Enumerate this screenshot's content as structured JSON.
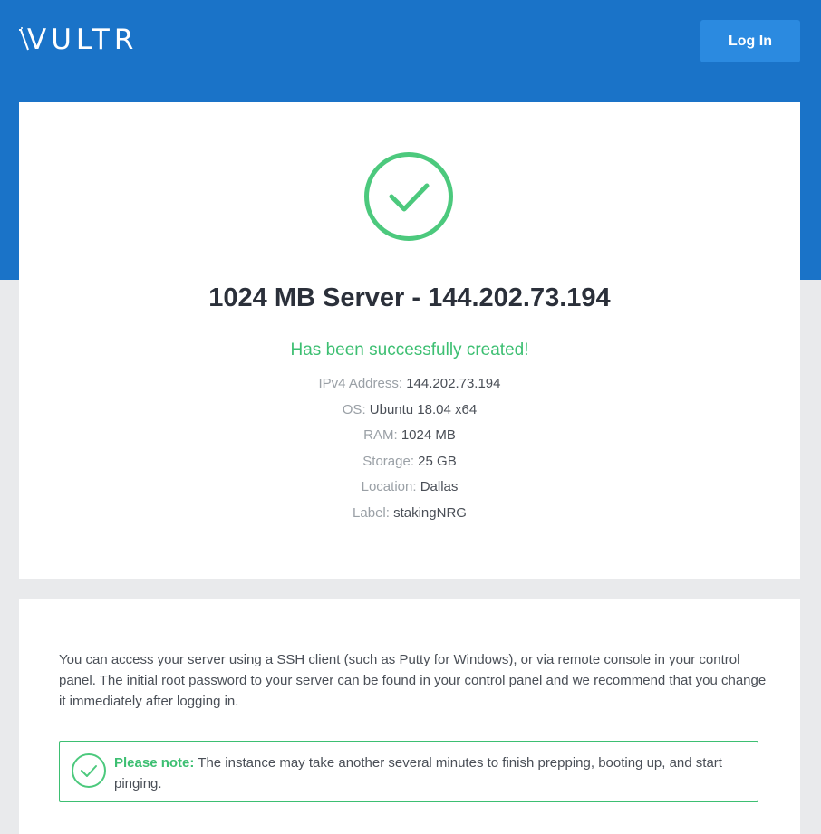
{
  "header": {
    "logo_text": "VULTR",
    "login_label": "Log In",
    "brand_color": "#1a73c8",
    "button_color": "#2b8ae0"
  },
  "server": {
    "title": "1024 MB Server - 144.202.73.194",
    "success_message": "Has been successfully created!",
    "success_color": "#3dbf72",
    "details": [
      {
        "label": "IPv4 Address:",
        "value": "144.202.73.194"
      },
      {
        "label": "OS:",
        "value": "Ubuntu 18.04 x64"
      },
      {
        "label": "RAM:",
        "value": "1024 MB"
      },
      {
        "label": "Storage:",
        "value": "25 GB"
      },
      {
        "label": "Location:",
        "value": "Dallas"
      },
      {
        "label": "Label:",
        "value": "stakingNRG"
      }
    ]
  },
  "info": {
    "access_text": "You can access your server using a SSH client (such as Putty for Windows), or via remote console in your control panel. The initial root password to your server can be found in your control panel and we recommend that you change it immediately after logging in.",
    "note_label": "Please note:",
    "note_text": "The instance may take another several minutes to finish prepping, booting up, and start pinging."
  },
  "icons": {
    "logo": "vultr-logo-icon",
    "success": "check-circle-icon",
    "note": "check-circle-icon"
  }
}
